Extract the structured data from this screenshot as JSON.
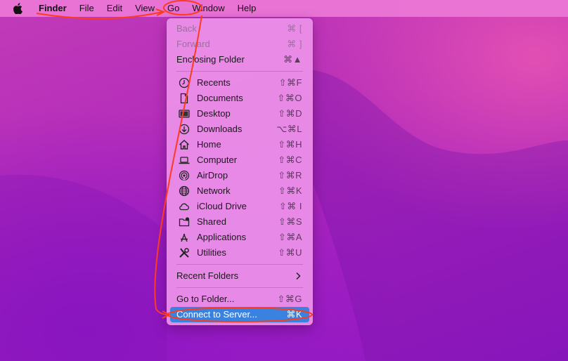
{
  "menubar": {
    "app_name": "Finder",
    "items": [
      "File",
      "Edit",
      "View",
      "Go",
      "Window",
      "Help"
    ]
  },
  "go_menu": {
    "back": {
      "label": "Back",
      "shortcut": "⌘ ["
    },
    "forward": {
      "label": "Forward",
      "shortcut": "⌘ ]"
    },
    "enclosing": {
      "label": "Enclosing Folder",
      "shortcut": "⌘▲"
    },
    "places": [
      {
        "label": "Recents",
        "shortcut": "⇧⌘F",
        "icon": "clock-icon"
      },
      {
        "label": "Documents",
        "shortcut": "⇧⌘O",
        "icon": "document-icon"
      },
      {
        "label": "Desktop",
        "shortcut": "⇧⌘D",
        "icon": "desktop-icon"
      },
      {
        "label": "Downloads",
        "shortcut": "⌥⌘L",
        "icon": "download-icon"
      },
      {
        "label": "Home",
        "shortcut": "⇧⌘H",
        "icon": "home-icon"
      },
      {
        "label": "Computer",
        "shortcut": "⇧⌘C",
        "icon": "laptop-icon"
      },
      {
        "label": "AirDrop",
        "shortcut": "⇧⌘R",
        "icon": "airdrop-icon"
      },
      {
        "label": "Network",
        "shortcut": "⇧⌘K",
        "icon": "globe-icon"
      },
      {
        "label": "iCloud Drive",
        "shortcut": "⇧⌘ I",
        "icon": "cloud-icon"
      },
      {
        "label": "Shared",
        "shortcut": "⇧⌘S",
        "icon": "shared-folder-icon"
      },
      {
        "label": "Applications",
        "shortcut": "⇧⌘A",
        "icon": "applications-icon"
      },
      {
        "label": "Utilities",
        "shortcut": "⇧⌘U",
        "icon": "tools-icon"
      }
    ],
    "recent_folders": {
      "label": "Recent Folders"
    },
    "go_to_folder": {
      "label": "Go to Folder...",
      "shortcut": "⇧⌘G"
    },
    "connect_to_server": {
      "label": "Connect to Server...",
      "shortcut": "⌘K"
    }
  },
  "colors": {
    "highlight": "#3a82e0",
    "annotation": "#ff3b1f"
  }
}
